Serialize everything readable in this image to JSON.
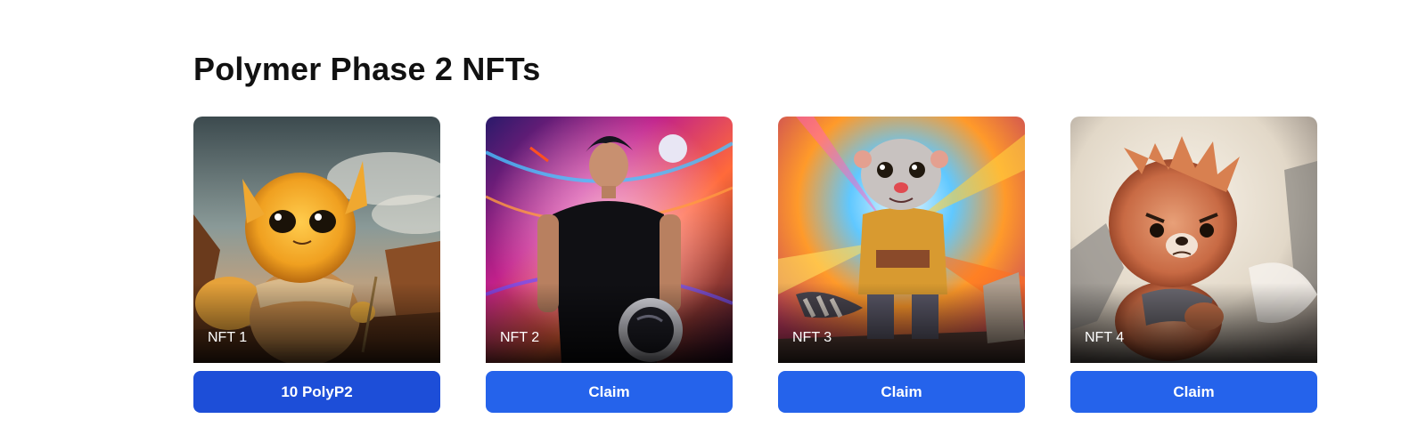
{
  "section": {
    "title": "Polymer Phase 2 NFTs"
  },
  "nfts": [
    {
      "name": "NFT 1",
      "button_label": "10 PolyP2",
      "image": "golden-fluffy-creature-explorer"
    },
    {
      "name": "NFT 2",
      "button_label": "Claim",
      "image": "man-holding-space-helmet"
    },
    {
      "name": "NFT 3",
      "button_label": "Claim",
      "image": "meerkat-adventurer-jacket"
    },
    {
      "name": "NFT 4",
      "button_label": "Claim",
      "image": "angry-fluffy-pomeranian"
    }
  ],
  "colors": {
    "button": "#2563eb",
    "button_owned": "#1d4ed8",
    "label_text": "#ffffff"
  }
}
